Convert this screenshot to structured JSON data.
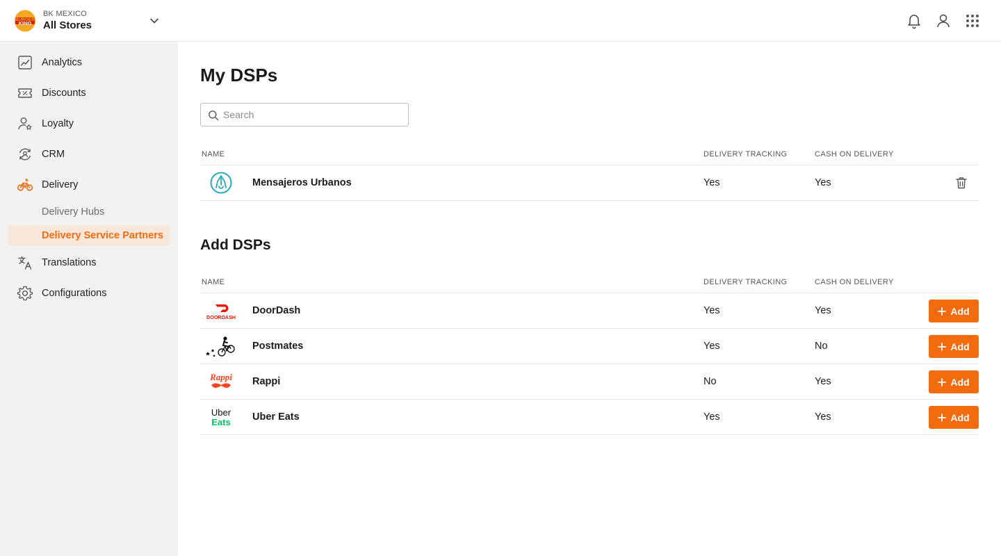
{
  "header": {
    "org_name": "BK MEXICO",
    "store": "All Stores",
    "brand_logo_text": [
      "BURGER",
      "KING"
    ]
  },
  "sidebar": {
    "items": [
      {
        "label": "Analytics",
        "icon": "analytics-icon"
      },
      {
        "label": "Discounts",
        "icon": "discount-icon"
      },
      {
        "label": "Loyalty",
        "icon": "loyalty-icon"
      },
      {
        "label": "CRM",
        "icon": "crm-icon"
      },
      {
        "label": "Delivery",
        "icon": "bike-icon"
      },
      {
        "label": "Translations",
        "icon": "translate-icon"
      },
      {
        "label": "Configurations",
        "icon": "gear-icon"
      }
    ],
    "delivery_sub": [
      {
        "label": "Delivery Hubs"
      },
      {
        "label": "Delivery Service Partners"
      }
    ]
  },
  "main": {
    "title": "My DSPs",
    "search_placeholder": "Search",
    "columns": {
      "name": "NAME",
      "tracking": "DELIVERY TRACKING",
      "cod": "CASH ON DELIVERY"
    },
    "my_dsps": [
      {
        "name": "Mensajeros Urbanos",
        "tracking": "Yes",
        "cod": "Yes"
      }
    ],
    "add_title": "Add DSPs",
    "add_label": "Add",
    "add_dsps": [
      {
        "name": "DoorDash",
        "tracking": "Yes",
        "cod": "Yes",
        "logo_text": "DOORDASH"
      },
      {
        "name": "Postmates",
        "tracking": "Yes",
        "cod": "No"
      },
      {
        "name": "Rappi",
        "tracking": "No",
        "cod": "Yes",
        "logo_text": "Rappi"
      },
      {
        "name": "Uber Eats",
        "tracking": "Yes",
        "cod": "Yes",
        "logo_text": [
          "Uber",
          "Eats"
        ]
      }
    ]
  },
  "colors": {
    "accent": "#f26b0f",
    "accent_bg": "#fbe7d9",
    "sidebar_bg": "#f2f2f2"
  }
}
